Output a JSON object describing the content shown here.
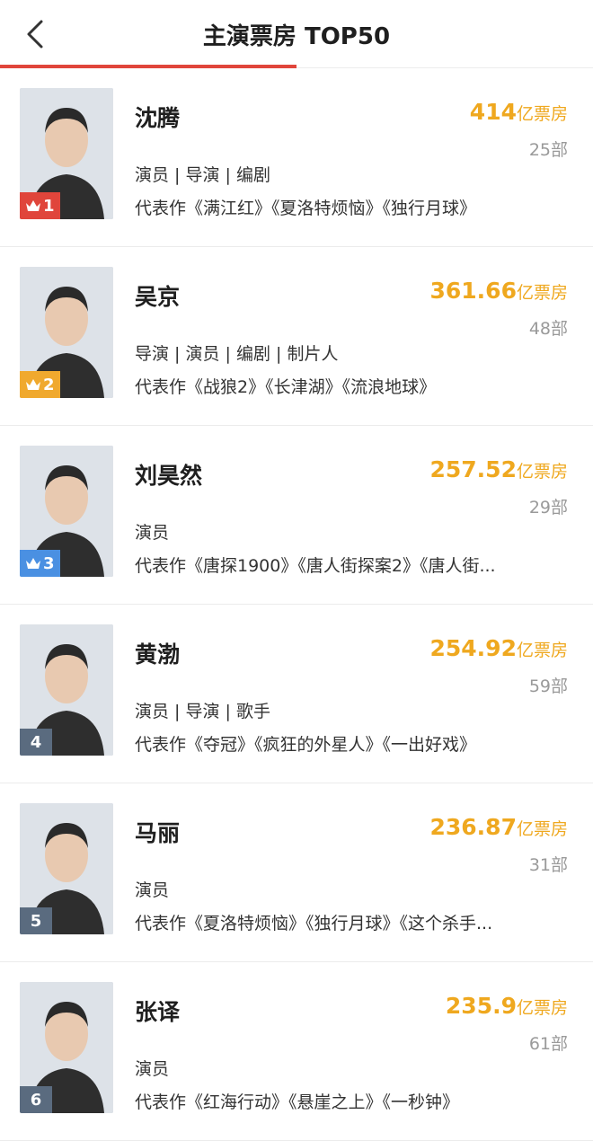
{
  "header": {
    "title": "主演票房 TOP50",
    "back_icon": "chevron-left-icon"
  },
  "colors": {
    "accent": "#e0453b",
    "box_office": "#efa81f",
    "rank_1": "#e0453b",
    "rank_2": "#f0a92e",
    "rank_3": "#4a90e2",
    "rank_other": "#5a6b7f"
  },
  "actors": [
    {
      "rank": "1",
      "rank_badge": "crown-icon",
      "name": "沈腾",
      "box_office": "414",
      "unit": "亿票房",
      "films": "25部",
      "roles": "演员 | 导演 | 编剧",
      "works": "代表作《满江红》《夏洛特烦恼》《独行月球》"
    },
    {
      "rank": "2",
      "rank_badge": "crown-icon",
      "name": "吴京",
      "box_office": "361.66",
      "unit": "亿票房",
      "films": "48部",
      "roles": "导演 | 演员 | 编剧 | 制片人",
      "works": "代表作《战狼2》《长津湖》《流浪地球》"
    },
    {
      "rank": "3",
      "rank_badge": "crown-icon",
      "name": "刘昊然",
      "box_office": "257.52",
      "unit": "亿票房",
      "films": "29部",
      "roles": "演员",
      "works": "代表作《唐探1900》《唐人街探案2》《唐人街..."
    },
    {
      "rank": "4",
      "name": "黄渤",
      "box_office": "254.92",
      "unit": "亿票房",
      "films": "59部",
      "roles": "演员 | 导演 | 歌手",
      "works": "代表作《夺冠》《疯狂的外星人》《一出好戏》"
    },
    {
      "rank": "5",
      "name": "马丽",
      "box_office": "236.87",
      "unit": "亿票房",
      "films": "31部",
      "roles": "演员",
      "works": "代表作《夏洛特烦恼》《独行月球》《这个杀手..."
    },
    {
      "rank": "6",
      "name": "张译",
      "box_office": "235.9",
      "unit": "亿票房",
      "films": "61部",
      "roles": "演员",
      "works": "代表作《红海行动》《悬崖之上》《一秒钟》"
    }
  ]
}
